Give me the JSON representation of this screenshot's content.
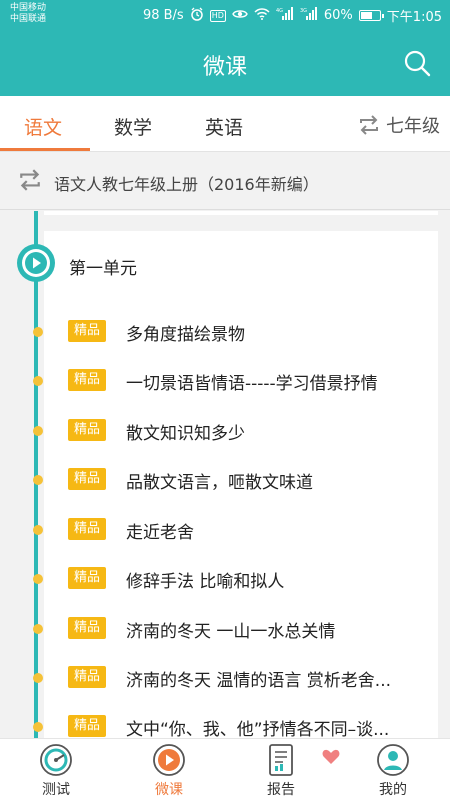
{
  "status_bar": {
    "carrier_1": "中国移动",
    "carrier_2": "中国联通",
    "speed": "98 B/s",
    "network_4g": "4G",
    "network_3g": "3G",
    "battery": "60%",
    "time": "下午1:05"
  },
  "header": {
    "title": "微课"
  },
  "subject_tabs": [
    {
      "label": "语文",
      "active": true
    },
    {
      "label": "数学",
      "active": false
    },
    {
      "label": "英语",
      "active": false
    }
  ],
  "grade": {
    "label": "七年级"
  },
  "textbook": {
    "label": "语文人教七年级上册（2016年新编）"
  },
  "unit": {
    "title": "第一单元"
  },
  "badge_label": "精品",
  "lessons": [
    {
      "title": "多角度描绘景物"
    },
    {
      "title": "一切景语皆情语-----学习借景抒情"
    },
    {
      "title": "散文知识知多少"
    },
    {
      "title": "品散文语言，咂散文味道"
    },
    {
      "title": "走近老舍"
    },
    {
      "title": "修辞手法 比喻和拟人"
    },
    {
      "title": "济南的冬天 一山一水总关情"
    },
    {
      "title": "济南的冬天 温情的语言 赏析老舍..."
    },
    {
      "title": "文中“你、我、他”抒情各不同–谈..."
    }
  ],
  "bottom_nav": [
    {
      "label": "测试",
      "icon": "test-gauge-icon",
      "active": false
    },
    {
      "label": "微课",
      "icon": "play-circle-icon",
      "active": true
    },
    {
      "label": "报告",
      "icon": "report-document-icon",
      "active": false
    },
    {
      "label": "我的",
      "icon": "user-avatar-icon",
      "active": false
    }
  ],
  "colors": {
    "teal": "#2db8b5",
    "orange": "#ef7a3c",
    "badge": "#f6b814",
    "dot": "#f5c238"
  }
}
